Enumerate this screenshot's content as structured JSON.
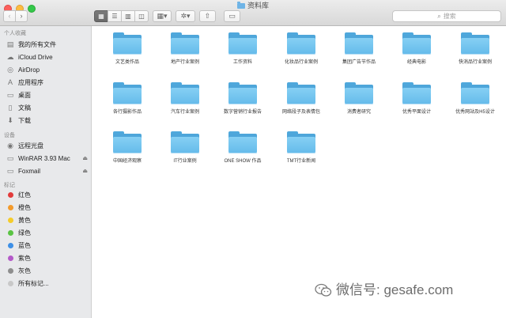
{
  "window": {
    "title": "资料库"
  },
  "toolbar": {
    "back_glyph": "‹",
    "forward_glyph": "›",
    "view_buttons": [
      {
        "icon": "icon-view-icon",
        "glyph": "▦",
        "active": true
      },
      {
        "icon": "list-view-icon",
        "glyph": "☰",
        "active": false
      },
      {
        "icon": "column-view-icon",
        "glyph": "▥",
        "active": false
      },
      {
        "icon": "coverflow-view-icon",
        "glyph": "◫",
        "active": false
      }
    ],
    "arrange_glyph": "▦▾",
    "action_glyph": "✲▾",
    "share_glyph": "⇧",
    "tag_glyph": "▭",
    "search_icon": "⌕",
    "search_placeholder": "搜索"
  },
  "sidebar": {
    "favorites_heading": "个人收藏",
    "favorites": [
      {
        "label": "我的所有文件",
        "icon": "all-files-icon",
        "glyph": "▤"
      },
      {
        "label": "iCloud Drive",
        "icon": "cloud-icon",
        "glyph": "☁"
      },
      {
        "label": "AirDrop",
        "icon": "airdrop-icon",
        "glyph": "◎"
      },
      {
        "label": "应用程序",
        "icon": "applications-icon",
        "glyph": "A"
      },
      {
        "label": "桌面",
        "icon": "desktop-icon",
        "glyph": "▭"
      },
      {
        "label": "文稿",
        "icon": "documents-icon",
        "glyph": "▯"
      },
      {
        "label": "下载",
        "icon": "downloads-icon",
        "glyph": "⬇"
      }
    ],
    "devices_heading": "设备",
    "devices": [
      {
        "label": "远程光盘",
        "icon": "disc-icon",
        "glyph": "◉",
        "eject": false
      },
      {
        "label": "WinRAR 3.93 Mac",
        "icon": "drive-icon",
        "glyph": "▭",
        "eject": true
      },
      {
        "label": "Foxmail",
        "icon": "drive-icon",
        "glyph": "▭",
        "eject": true
      }
    ],
    "eject_glyph": "⏏",
    "tags_heading": "标记",
    "tags": [
      {
        "label": "红色",
        "color": "#e23b3b"
      },
      {
        "label": "橙色",
        "color": "#f39a2b"
      },
      {
        "label": "黄色",
        "color": "#f5cc2b"
      },
      {
        "label": "绿色",
        "color": "#5ac443"
      },
      {
        "label": "蓝色",
        "color": "#3d8fe6"
      },
      {
        "label": "紫色",
        "color": "#b45ac9"
      },
      {
        "label": "灰色",
        "color": "#8e8e8e"
      },
      {
        "label": "所有标记...",
        "color": "#c8c8c8"
      }
    ]
  },
  "folders": [
    "文艺类作品",
    "地产行业案例",
    "工作资料",
    "化妆品行业案例",
    "集团广告节作品",
    "经典电影",
    "快消品行业案例",
    "各行摄影作品",
    "汽车行业案例",
    "数字营销行业报告",
    "网络段子及表情包",
    "消费者研究",
    "优秀平面设计",
    "优秀网站及H5设计",
    "中国经济观察",
    "IT行业案例",
    "ONE SHOW 作品",
    "TMT行业新闻"
  ],
  "watermark": {
    "text": "微信号: gesafe.com"
  },
  "colors": {
    "folder": "#64baea",
    "sidebar": "#e8e9eb",
    "accent": "#4ea6da"
  }
}
